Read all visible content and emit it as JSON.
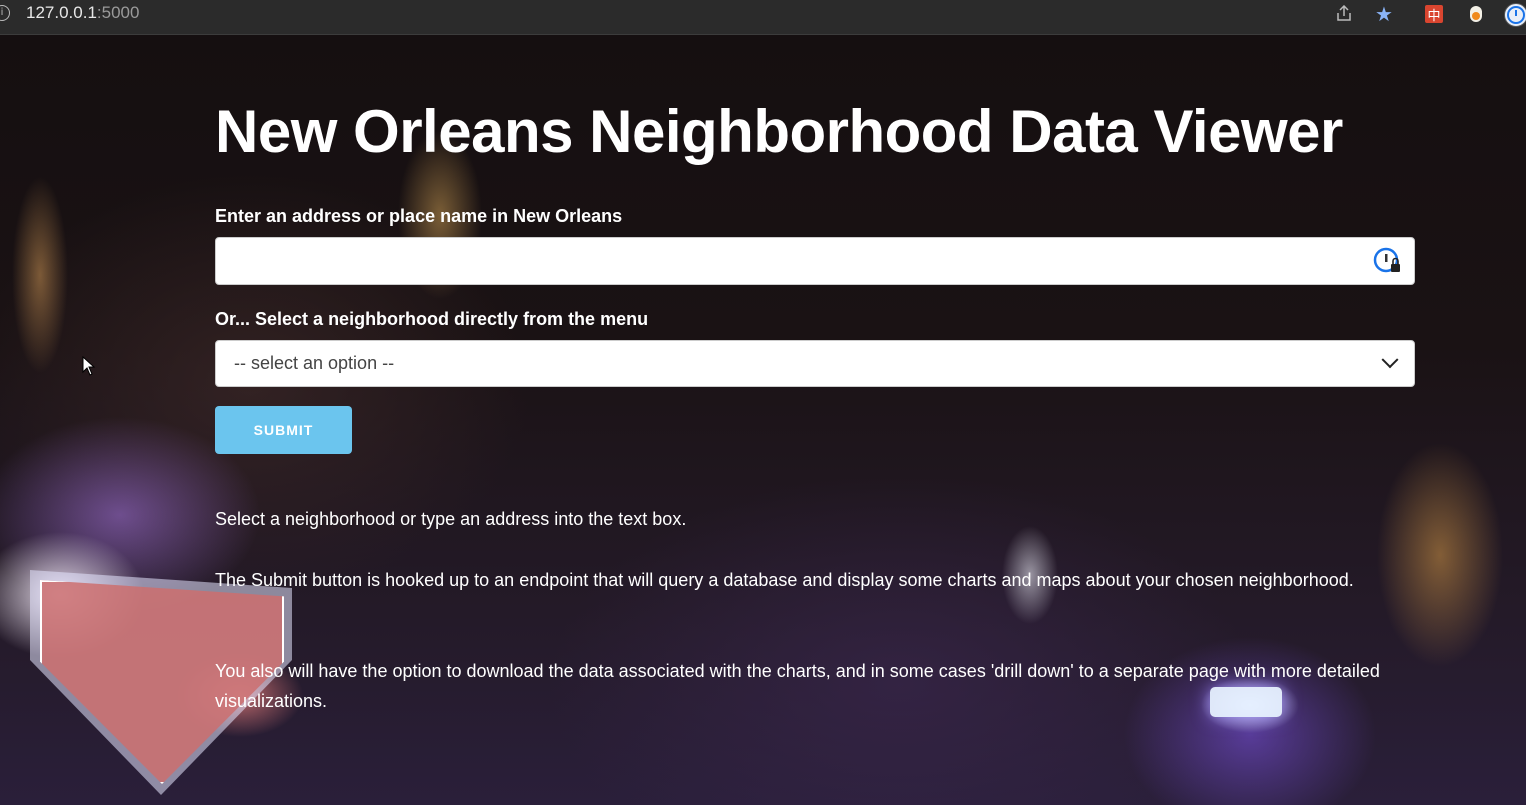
{
  "browser": {
    "url_host": "127.0.0.1",
    "url_port": ":5000",
    "translate_glyph": "中"
  },
  "header": {
    "title": "New Orleans Neighborhood Data Viewer"
  },
  "form": {
    "address_label": "Enter an address or place name in New Orleans",
    "address_value": "",
    "select_label": "Or... Select a neighborhood directly from the menu",
    "select_value": "-- select an option --",
    "submit_label": "SUBMIT"
  },
  "instructions": [
    "Select a neighborhood or type an address into the text box.",
    "The Submit button is hooked up to an endpoint that will query a database and display some charts and maps about your chosen neighborhood.",
    "You also will have the option to download the data associated with the charts, and in some cases 'drill down' to a separate page with more detailed visualizations."
  ],
  "colors": {
    "submit_bg": "#6bc5ee",
    "browser_bar": "#2b2b2b",
    "star": "#8ab4f8"
  },
  "icons": [
    "info-icon",
    "share-icon",
    "star-icon",
    "translate-icon",
    "extension-icon",
    "profile-icon",
    "password-manager-icon",
    "chevron-down-icon",
    "mouse-cursor-icon"
  ]
}
